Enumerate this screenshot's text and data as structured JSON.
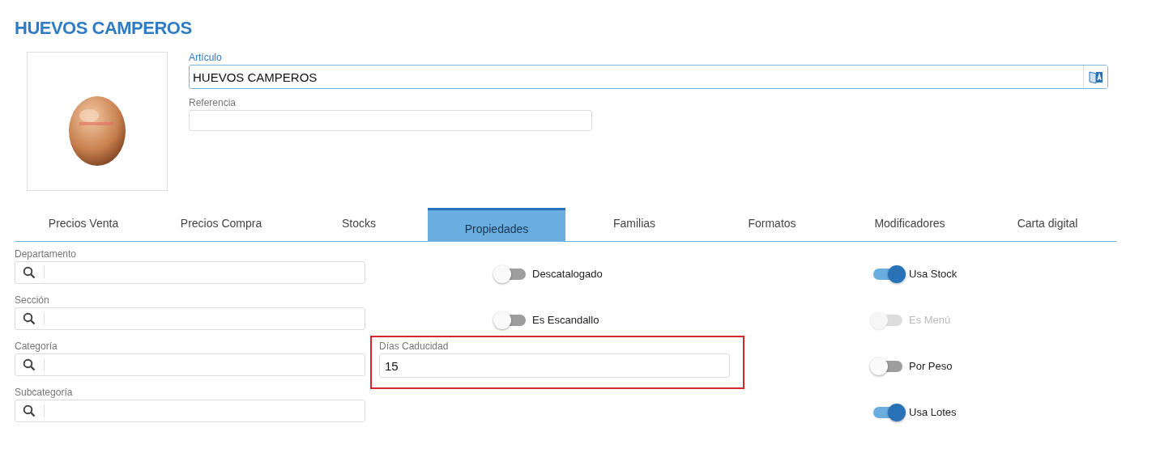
{
  "title": "HUEVOS CAMPEROS",
  "articulo": {
    "label": "Artículo",
    "value": "HUEVOS CAMPEROS",
    "focused": true
  },
  "referencia": {
    "label": "Referencia"
  },
  "tabs": [
    {
      "label": "Precios Venta",
      "selected": false
    },
    {
      "label": "Precios Compra",
      "selected": false
    },
    {
      "label": "Stocks",
      "selected": false
    },
    {
      "label": "Propiedades",
      "selected": true
    },
    {
      "label": "Familias",
      "selected": false
    },
    {
      "label": "Formatos",
      "selected": false
    },
    {
      "label": "Modificadores",
      "selected": false
    },
    {
      "label": "Carta digital",
      "selected": false
    }
  ],
  "lookup_fields": [
    {
      "label": "Departamento"
    },
    {
      "label": "Sección"
    },
    {
      "label": "Categoría"
    },
    {
      "label": "Subcategoría"
    }
  ],
  "middle_toggles": [
    {
      "label": "Descatalogado",
      "on": false,
      "disabled": false
    },
    {
      "label": "Es Escandallo",
      "on": false,
      "disabled": false
    }
  ],
  "caducidad": {
    "label": "Días Caducidad",
    "value": "15",
    "highlighted": true
  },
  "right_toggles": [
    {
      "label": "Usa Stock",
      "on": true,
      "disabled": false
    },
    {
      "label": "Es Menú",
      "on": false,
      "disabled": true
    },
    {
      "label": "Por Peso",
      "on": false,
      "disabled": false
    },
    {
      "label": "Usa Lotes",
      "on": true,
      "disabled": false
    }
  ]
}
